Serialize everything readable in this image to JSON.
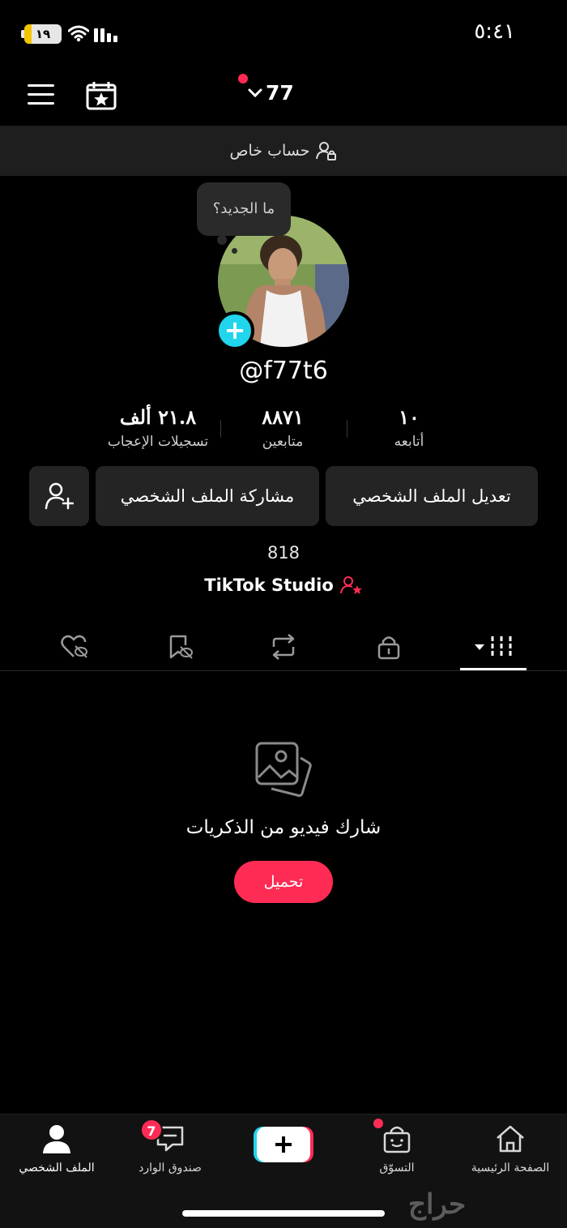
{
  "status_bar": {
    "time": "٥:٤١",
    "battery_level": "١٩",
    "battery_fraction": 0.19
  },
  "header": {
    "username": "77",
    "notification_dot": true
  },
  "private_account": {
    "label": "حساب خاص"
  },
  "profile": {
    "bubble_text": "ما الجديد؟",
    "handle": "@f77t6"
  },
  "stats": [
    {
      "value": "١٠",
      "label": "أتابعه"
    },
    {
      "value": "٨٨٧١",
      "label": "متابعين"
    },
    {
      "value": "٢١.٨ ألف",
      "label": "تسجيلات الإعجاب"
    }
  ],
  "buttons": {
    "edit_profile": "تعديل الملف الشخصي",
    "share_profile": "مشاركة الملف الشخصي"
  },
  "bio_count": "818",
  "studio_link": "TikTok Studio",
  "empty_state": {
    "message": "شارك فيديو من الذكريات",
    "upload_label": "تحميل"
  },
  "bottom_nav": {
    "home": "الصفحة الرئيسية",
    "shop": "التسوّق",
    "inbox": "صندوق الوارد",
    "inbox_badge": "7",
    "profile": "الملف الشخصي"
  },
  "watermark": "حراج",
  "colors": {
    "accent": "#fe2c55",
    "cyan": "#20d5ec",
    "battery": "#f5c400"
  }
}
